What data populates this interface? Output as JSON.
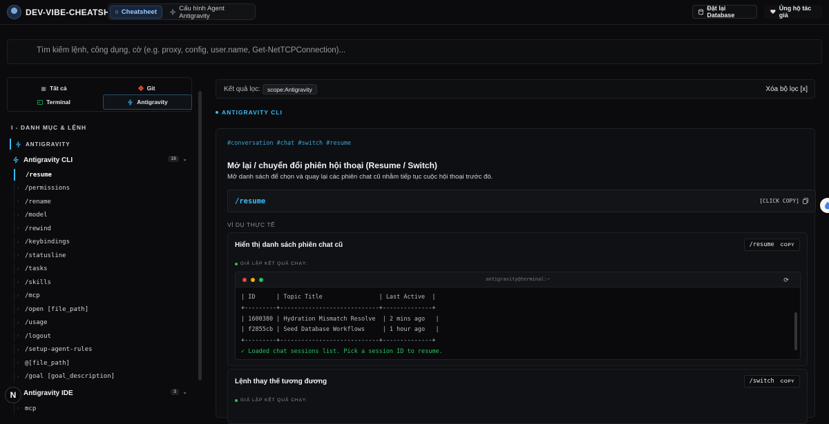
{
  "header": {
    "brand": "DEV-VIBE-CHEATSHEET",
    "tabs": [
      {
        "label": "Cheatsheet",
        "icon": "code-square-icon"
      },
      {
        "label": "Cấu hình Agent Antigravity",
        "icon": "sparkle-icon"
      }
    ],
    "reset_db": "Đặt lại Database",
    "support": "Ủng hộ tác giả"
  },
  "search": {
    "placeholder": "Tìm kiếm lệnh, công dụng, cờ (e.g. proxy, config, user.name, Get-NetTCPConnection)..."
  },
  "sidebar": {
    "filters": [
      {
        "label": "Tất cả",
        "icon": "grid-icon"
      },
      {
        "label": "Git",
        "icon": "git-icon"
      },
      {
        "label": "Terminal",
        "icon": "terminal-icon"
      },
      {
        "label": "Antigravity",
        "icon": "sparkle-icon"
      }
    ],
    "section_title": "I - DANH MỤC & LỆNH",
    "category": "ANTIGRAVITY",
    "groups": [
      {
        "label": "Antigravity CLI",
        "count": "16"
      },
      {
        "label": "Antigravity IDE",
        "count": "3"
      }
    ],
    "cli_items": [
      "/resume",
      "/permissions",
      "/rename",
      "/model",
      "/rewind",
      "/keybindings",
      "/statusline",
      "/tasks",
      "/skills",
      "/mcp",
      "/open [file_path]",
      "/usage",
      "/logout",
      "/setup-agent-rules",
      "@[file_path]",
      "/goal [goal_description]"
    ],
    "ide_items": [
      "mcp"
    ],
    "badge": "N"
  },
  "main": {
    "filter_label": "Kết quả lọc:",
    "filter_chip": "scope:Antigravity",
    "clear_filter": "Xóa bộ lọc [x]",
    "section_heading": "ANTIGRAVITY CLI",
    "card": {
      "tags": "#conversation #chat #switch #resume",
      "title": "Mở lại / chuyển đổi phiên hội thoại (Resume / Switch)",
      "description": "Mở danh sách để chọn và quay lại các phiên chat cũ nhằm tiếp tục cuộc hội thoại trước đó.",
      "command": "/resume",
      "copy_label": "[CLICK COPY]",
      "examples_label": "VÍ DỤ THỰC TẾ",
      "examples": [
        {
          "title": "Hiển thị danh sách phiên chat cũ",
          "command": "/resume",
          "copy": "COPY",
          "sim_label": "GIẢ LẬP KẾT QUẢ CHẠY:"
        },
        {
          "title": "Lệnh thay thế tương đương",
          "command": "/switch",
          "copy": "COPY",
          "sim_label": "GIẢ LẬP KẾT QUẢ CHẠY:"
        }
      ],
      "terminal": {
        "title": "antigravity@terminal:~",
        "lines": [
          "| ID      | Topic Title                | Last Active  |",
          "+---------+----------------------------+--------------+",
          "| 1600380 | Hydration Mismatch Resolve  | 2 mins ago   |",
          "| f2855cb | Seed Database Workflows     | 1 hour ago   |",
          "+---------+----------------------------+--------------+"
        ],
        "success": "✓ Loaded chat sessions list. Pick a session ID to resume."
      }
    }
  },
  "colors": {
    "accent": "#38bdf8",
    "success": "#22c55e",
    "git": "#f05033"
  }
}
